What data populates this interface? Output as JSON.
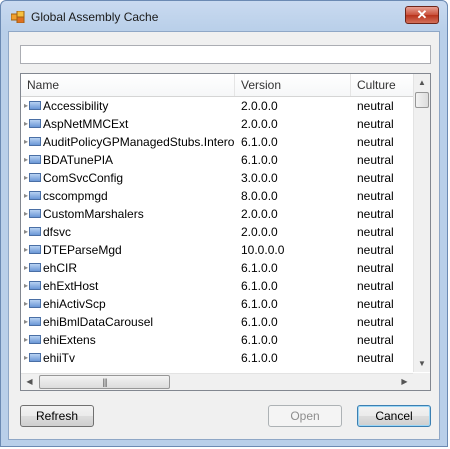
{
  "window": {
    "title": "Global Assembly Cache",
    "close_label": "✕"
  },
  "search": {
    "value": "",
    "placeholder": ""
  },
  "list": {
    "columns": [
      "Name",
      "Version",
      "Culture"
    ],
    "rows": [
      {
        "name": "Accessibility",
        "version": "2.0.0.0",
        "culture": "neutral"
      },
      {
        "name": "AspNetMMCExt",
        "version": "2.0.0.0",
        "culture": "neutral"
      },
      {
        "name": "AuditPolicyGPManagedStubs.Interop",
        "version": "6.1.0.0",
        "culture": "neutral"
      },
      {
        "name": "BDATunePIA",
        "version": "6.1.0.0",
        "culture": "neutral"
      },
      {
        "name": "ComSvcConfig",
        "version": "3.0.0.0",
        "culture": "neutral"
      },
      {
        "name": "cscompmgd",
        "version": "8.0.0.0",
        "culture": "neutral"
      },
      {
        "name": "CustomMarshalers",
        "version": "2.0.0.0",
        "culture": "neutral"
      },
      {
        "name": "dfsvc",
        "version": "2.0.0.0",
        "culture": "neutral"
      },
      {
        "name": "DTEParseMgd",
        "version": "10.0.0.0",
        "culture": "neutral"
      },
      {
        "name": "ehCIR",
        "version": "6.1.0.0",
        "culture": "neutral"
      },
      {
        "name": "ehExtHost",
        "version": "6.1.0.0",
        "culture": "neutral"
      },
      {
        "name": "ehiActivScp",
        "version": "6.1.0.0",
        "culture": "neutral"
      },
      {
        "name": "ehiBmlDataCarousel",
        "version": "6.1.0.0",
        "culture": "neutral"
      },
      {
        "name": "ehiExtens",
        "version": "6.1.0.0",
        "culture": "neutral"
      },
      {
        "name": "ehiiTv",
        "version": "6.1.0.0",
        "culture": "neutral"
      }
    ]
  },
  "buttons": {
    "refresh": "Refresh",
    "open": "Open",
    "cancel": "Cancel"
  },
  "icons": {
    "app": "app-icon",
    "assembly": "assembly-icon",
    "expand": "expand-icon"
  }
}
